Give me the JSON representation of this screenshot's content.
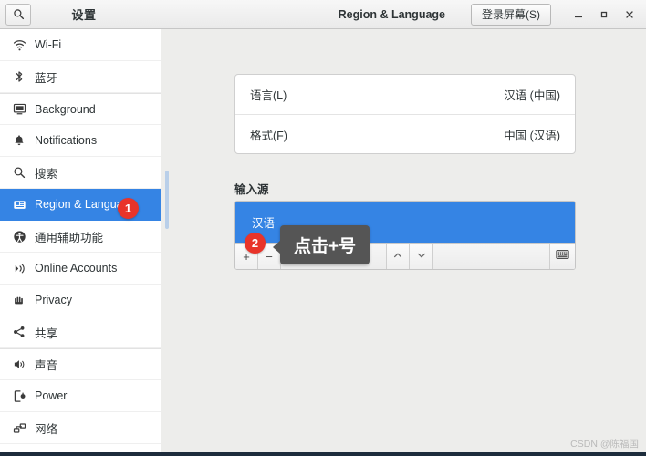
{
  "window": {
    "sidebar_title": "设置",
    "panel_title": "Region & Language",
    "login_screen_button": "登录屏幕(S)",
    "login_screen_button_mnemonic": "S",
    "search_icon": "search-icon",
    "minimize_icon": "minimize-icon",
    "maximize_icon": "maximize-icon",
    "close_icon": "close-icon"
  },
  "sidebar": {
    "items": [
      {
        "label": "Wi-Fi",
        "icon": "wifi-icon",
        "active": false
      },
      {
        "label": "蓝牙",
        "icon": "bluetooth-icon",
        "active": false
      },
      {
        "label": "Background",
        "icon": "monitor-icon",
        "active": false
      },
      {
        "label": "Notifications",
        "icon": "bell-icon",
        "active": false
      },
      {
        "label": "搜索",
        "icon": "search-icon",
        "active": false
      },
      {
        "label": "Region & Language",
        "icon": "language-icon",
        "active": true
      },
      {
        "label": "通用辅助功能",
        "icon": "accessibility-icon",
        "active": false
      },
      {
        "label": "Online Accounts",
        "icon": "online-accounts-icon",
        "active": false
      },
      {
        "label": "Privacy",
        "icon": "privacy-hand-icon",
        "active": false
      },
      {
        "label": "共享",
        "icon": "share-icon",
        "active": false
      },
      {
        "label": "声音",
        "icon": "sound-icon",
        "active": false
      },
      {
        "label": "Power",
        "icon": "power-icon",
        "active": false
      },
      {
        "label": "网络",
        "icon": "network-icon",
        "active": false
      }
    ]
  },
  "main": {
    "rows": [
      {
        "key": "语言(L)",
        "key_mnemonic": "L",
        "value": "汉语 (中国)"
      },
      {
        "key": "格式(F)",
        "key_mnemonic": "F",
        "value": "中国 (汉语)"
      }
    ],
    "input_sources_label": "输入源",
    "input_sources": [
      {
        "name": "汉语",
        "selected": true
      }
    ],
    "toolbar": {
      "add_label": "+",
      "remove_label": "−",
      "move_up_icon": "chevron-up-icon",
      "move_down_icon": "chevron-down-icon",
      "keyboard_icon": "keyboard-icon"
    }
  },
  "annotations": {
    "badges": [
      {
        "number": "1"
      },
      {
        "number": "2"
      }
    ],
    "tooltip_text": "点击+号"
  },
  "watermark": "CSDN @陈福国",
  "colors": {
    "accent": "#3584e4",
    "badge": "#e8342a",
    "tooltip_bg": "#555555",
    "content_bg": "#ededeb"
  }
}
